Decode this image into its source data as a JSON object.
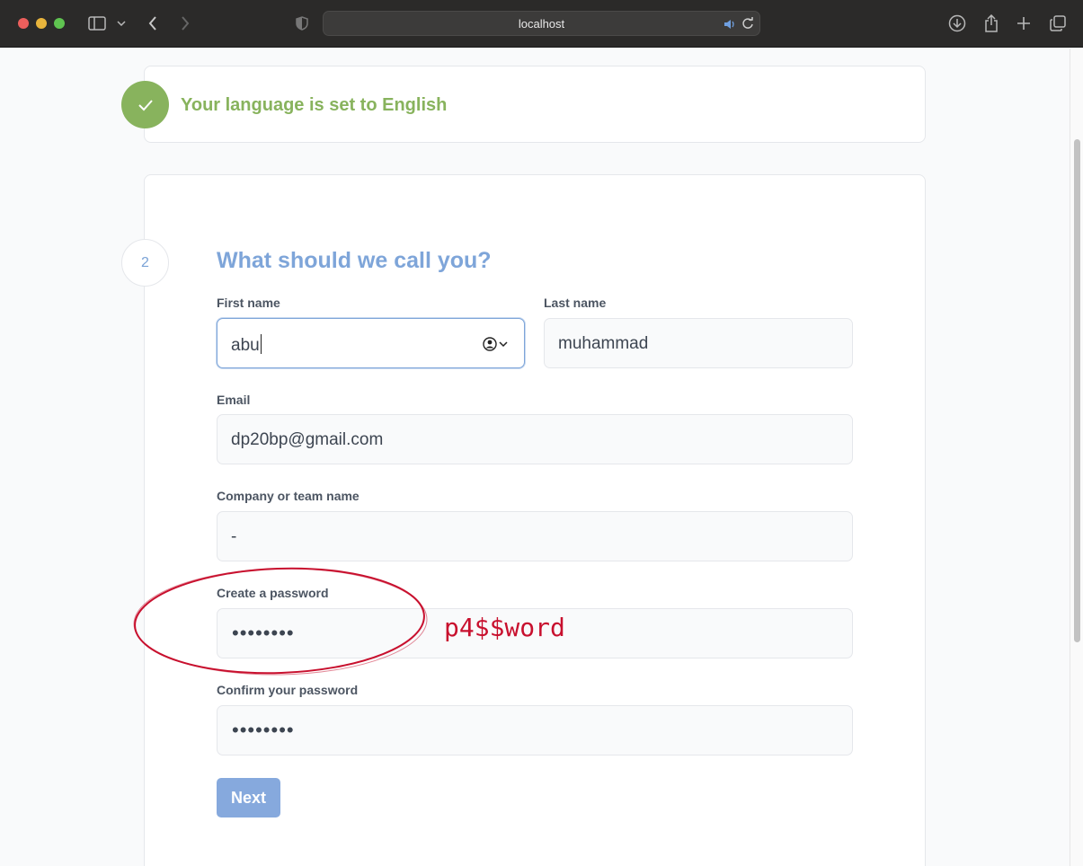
{
  "browser": {
    "url": "localhost"
  },
  "language_banner": {
    "text": "Your language is set to English",
    "icon": "check-icon",
    "color": "#88b35d"
  },
  "form": {
    "step_number": "2",
    "title": "What should we call you?",
    "first_name": {
      "label": "First name",
      "value": "abu"
    },
    "last_name": {
      "label": "Last name",
      "value": "muhammad"
    },
    "email": {
      "label": "Email",
      "value": "dp20bp@gmail.com"
    },
    "company": {
      "label": "Company or team name",
      "value": "-"
    },
    "password": {
      "label": "Create a password",
      "value": "••••••••"
    },
    "confirm_password": {
      "label": "Confirm your password",
      "value": "••••••••"
    },
    "next_label": "Next"
  },
  "annotation": {
    "text": "p4$$word",
    "color": "#c8102e"
  },
  "colors": {
    "accent": "#7ea5d9",
    "button": "#86a9dd",
    "success": "#88b35d"
  }
}
